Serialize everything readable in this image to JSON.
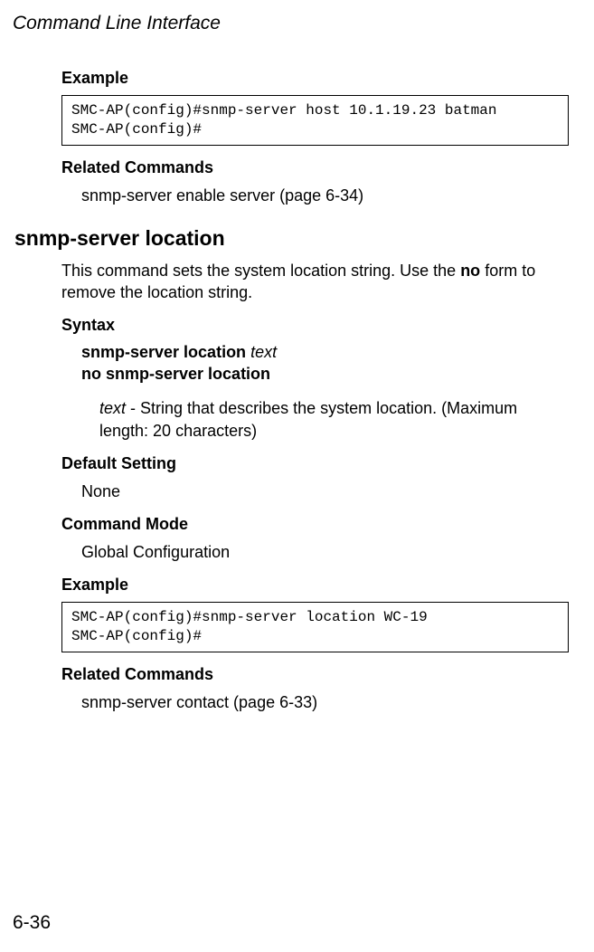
{
  "header": {
    "title": "Command Line Interface"
  },
  "section1": {
    "exampleLabel": "Example",
    "codeLine1": "SMC-AP(config)#snmp-server host 10.1.19.23 batman",
    "codeLine2": "SMC-AP(config)#",
    "relatedLabel": "Related Commands",
    "relatedText": "snmp-server enable server (page 6-34)"
  },
  "section2": {
    "title": "snmp-server location",
    "descPart1": "This command sets the system location string. Use the ",
    "descBold": "no",
    "descPart2": " form to remove the location string.",
    "syntaxLabel": "Syntax",
    "syntaxLine1Bold": "snmp-server location ",
    "syntaxLine1Italic": "text",
    "syntaxLine2": "no snmp-server location",
    "paramItalic": "text",
    "paramText": " - String that describes the system location. (Maximum length: 20 characters)",
    "defaultLabel": "Default Setting",
    "defaultValue": "None",
    "modeLabel": "Command Mode",
    "modeValue": "Global Configuration",
    "exampleLabel": "Example",
    "codeLine1": "SMC-AP(config)#snmp-server location WC-19",
    "codeLine2": "SMC-AP(config)#",
    "relatedLabel": "Related Commands",
    "relatedText": "snmp-server contact (page 6-33)"
  },
  "footer": {
    "pageNumber": "6-36"
  }
}
